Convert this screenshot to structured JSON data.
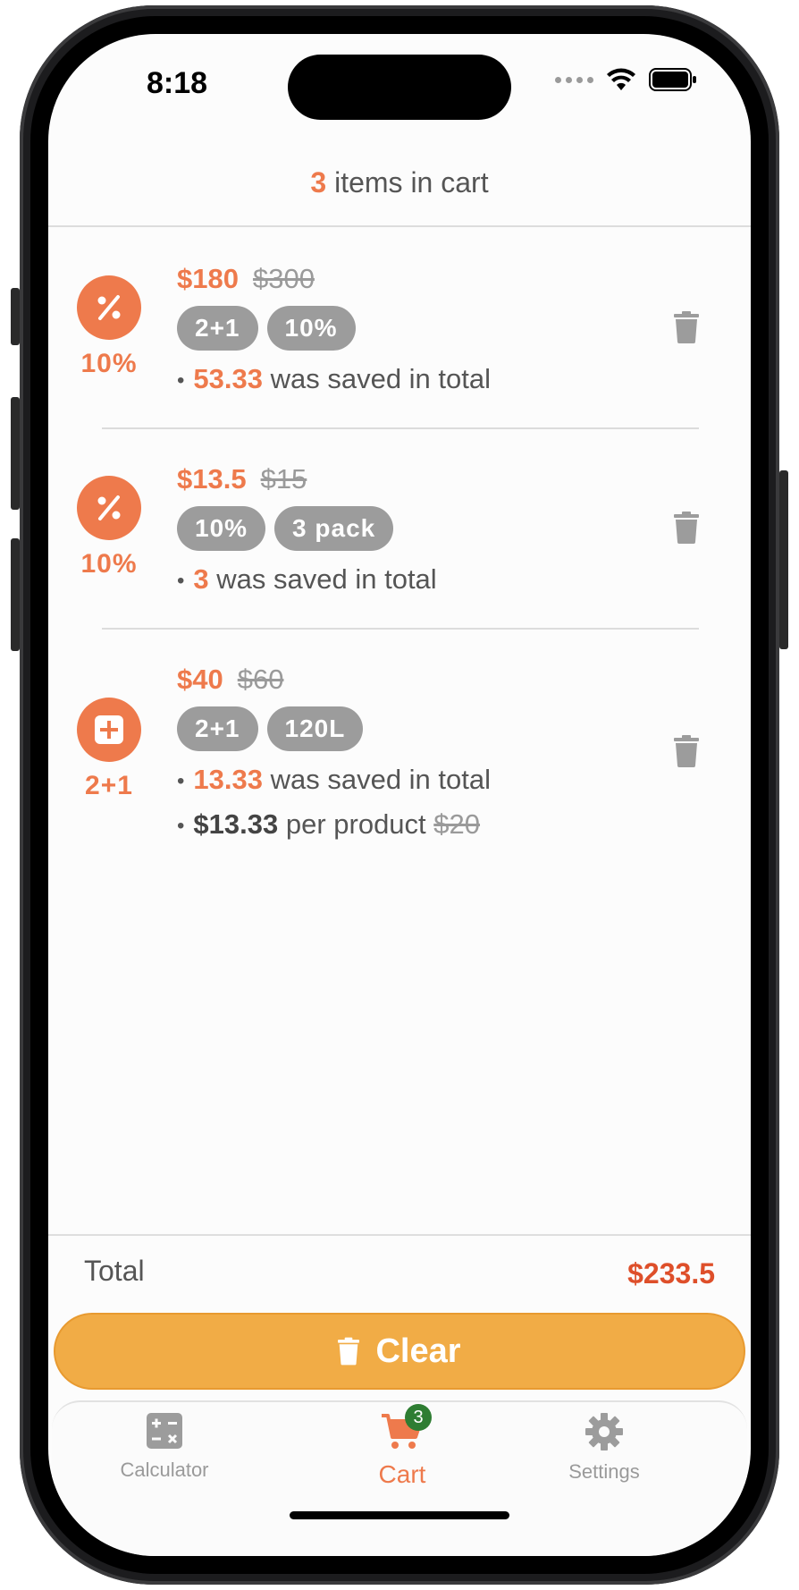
{
  "status_bar": {
    "time": "8:18"
  },
  "header": {
    "count": "3",
    "text": " items in cart"
  },
  "items": [
    {
      "badge_icon": "percent-icon",
      "badge_label": "10%",
      "price_new": "$180",
      "price_old": "$300",
      "tags": [
        "2+1",
        "10%"
      ],
      "saved_value": "53.33",
      "saved_text": " was saved in total"
    },
    {
      "badge_icon": "percent-icon",
      "badge_label": "10%",
      "price_new": "$13.5",
      "price_old": "$15",
      "tags": [
        "10%",
        "3 pack"
      ],
      "saved_value": "3",
      "saved_text": " was saved in total"
    },
    {
      "badge_icon": "plus-square-icon",
      "badge_label": "2+1",
      "price_new": "$40",
      "price_old": "$60",
      "tags": [
        "2+1",
        "120L"
      ],
      "saved_value": "13.33",
      "saved_text": " was saved in total",
      "per_product_value": "$13.33",
      "per_product_text": " per product ",
      "per_product_old": "$20"
    }
  ],
  "total": {
    "label": "Total",
    "value": "$233.5"
  },
  "clear_button": {
    "label": "Clear"
  },
  "tabs": [
    {
      "label": "Calculator",
      "icon": "calculator-icon"
    },
    {
      "label": "Cart",
      "icon": "cart-icon",
      "badge": "3"
    },
    {
      "label": "Settings",
      "icon": "gear-icon"
    }
  ],
  "colors": {
    "accent": "#ee7a4c",
    "total": "#de4f2a",
    "button": "#f1ac46",
    "tag": "#9c9c9c",
    "cart_badge": "#2e7d32"
  }
}
